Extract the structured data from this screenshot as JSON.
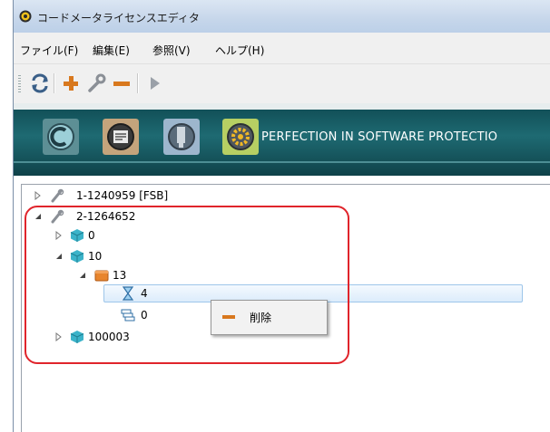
{
  "window": {
    "title": "コードメータライセンスエディタ"
  },
  "menu": [
    {
      "label": "ファイル(F)"
    },
    {
      "label": "編集(E)"
    },
    {
      "label": "参照(V)"
    },
    {
      "label": "ヘルプ(H)"
    }
  ],
  "toolbar": {
    "buttons": [
      {
        "icon": "refresh-icon"
      },
      {
        "icon": "plus-icon"
      },
      {
        "icon": "wrench-icon"
      },
      {
        "icon": "minus-icon"
      },
      {
        "icon": "play-icon"
      }
    ]
  },
  "banner": {
    "text": "PERFECTION IN SOFTWARE PROTECTIO",
    "icons": [
      "codemeter-icon",
      "license-icon",
      "container-icon",
      "gear-icon"
    ]
  },
  "tree": {
    "nodes": [
      {
        "label": "1-1240959 [FSB]",
        "icon": "key-icon",
        "expanded": false
      },
      {
        "label": "2-1264652",
        "icon": "key-icon",
        "expanded": true
      },
      {
        "label": "0",
        "icon": "cube-icon",
        "expanded": false
      },
      {
        "label": "10",
        "icon": "cube-icon",
        "expanded": true
      },
      {
        "label": "13",
        "icon": "folder-icon",
        "expanded": true
      },
      {
        "label": "4",
        "icon": "hourglass-icon",
        "selected": true
      },
      {
        "label": "0",
        "icon": "stack-icon"
      },
      {
        "label": "100003",
        "icon": "cube-icon",
        "expanded": false
      }
    ]
  },
  "context_menu": {
    "items": [
      {
        "label": "削除",
        "icon": "minus-icon"
      }
    ]
  },
  "colors": {
    "banner": "#1e6a72",
    "highlight": "#e0242b",
    "minus": "#d8781e",
    "plus": "#d8781e"
  }
}
